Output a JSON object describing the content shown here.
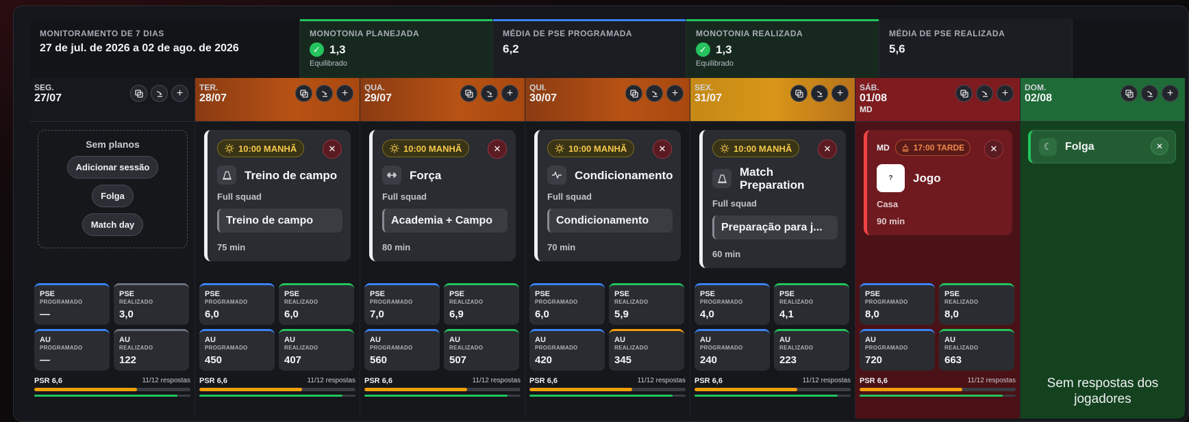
{
  "summary": {
    "monitor_label": "MONITORAMENTO DE 7 DIAS",
    "range": "27 de jul. de 2026 a 02 de ago. de 2026",
    "stats": [
      {
        "label": "MONOTONIA PLANEJADA",
        "value": "1,3",
        "note": "Equilibrado",
        "check": true,
        "accent": "#22c55e"
      },
      {
        "label": "MÉDIA DE PSE PROGRAMADA",
        "value": "6,2",
        "note": "",
        "check": false,
        "accent": "#3b82f6"
      },
      {
        "label": "MONOTONIA REALIZADA",
        "value": "1,3",
        "note": "Equilibrado",
        "check": true,
        "accent": "#22c55e"
      },
      {
        "label": "MÉDIA DE PSE REALIZADA",
        "value": "5,6",
        "note": "",
        "check": false,
        "accent": ""
      }
    ]
  },
  "labels": {
    "pse": "PSE",
    "au": "AU",
    "programado": "PROGRAMADO",
    "realizado": "REALIZADO",
    "psr": "PSR",
    "no_plans": "Sem planos",
    "add_session": "Adicionar sessão",
    "rest": "Folga",
    "match_day": "Match day",
    "no_responses": "Sem respostas dos jogadores"
  },
  "icons": {
    "copy": "copy-icon",
    "move": "arrow-turn-icon",
    "add": "plus-icon",
    "remove": "close-icon",
    "morning": "sun-icon",
    "afternoon": "sunset-icon",
    "rest": "moon-icon"
  },
  "days": [
    {
      "name": "SEG.",
      "date": "27/07",
      "tag": "",
      "kind": "empty",
      "pse_prog": "—",
      "pse_real": "3,0",
      "au_prog": "—",
      "au_real": "122",
      "pse_real_color": "#6b7280",
      "au_real_color": "#6b7280",
      "psr": "6,6",
      "responses": "11/12 respostas",
      "psr_fill": 0.66,
      "resp_fill": 0.917
    },
    {
      "name": "TER.",
      "date": "28/07",
      "tag": "",
      "kind": "session",
      "time": "10:00 MANHÃ",
      "title": "Treino de campo",
      "group": "Full squad",
      "plan": "Treino de campo",
      "duration": "75 min",
      "icon": "cone-icon",
      "pse_prog": "6,0",
      "pse_real": "6,0",
      "au_prog": "450",
      "au_real": "407",
      "pse_real_color": "#22c55e",
      "au_real_color": "#22c55e",
      "psr": "6,6",
      "responses": "11/12 respostas",
      "psr_fill": 0.66,
      "resp_fill": 0.917
    },
    {
      "name": "QUA.",
      "date": "29/07",
      "tag": "",
      "kind": "session",
      "time": "10:00 MANHÃ",
      "title": "Força",
      "group": "Full squad",
      "plan": "Academia + Campo",
      "duration": "80 min",
      "icon": "dumbbell-icon",
      "pse_prog": "7,0",
      "pse_real": "6,9",
      "au_prog": "560",
      "au_real": "507",
      "pse_real_color": "#22c55e",
      "au_real_color": "#22c55e",
      "psr": "6,6",
      "responses": "11/12 respostas",
      "psr_fill": 0.66,
      "resp_fill": 0.917
    },
    {
      "name": "QUI.",
      "date": "30/07",
      "tag": "",
      "kind": "session",
      "time": "10:00 MANHÃ",
      "title": "Condicionamento",
      "group": "Full squad",
      "plan": "Condicionamento",
      "duration": "70 min",
      "icon": "pulse-icon",
      "pse_prog": "6,0",
      "pse_real": "5,9",
      "au_prog": "420",
      "au_real": "345",
      "pse_real_color": "#22c55e",
      "au_real_color": "#f59e0b",
      "psr": "6,6",
      "responses": "11/12 respostas",
      "psr_fill": 0.66,
      "resp_fill": 0.917
    },
    {
      "name": "SEX.",
      "date": "31/07",
      "tag": "",
      "kind": "session",
      "time": "10:00 MANHÃ",
      "title": "Match Preparation",
      "group": "Full squad",
      "plan": "Preparação para j...",
      "duration": "60 min",
      "icon": "cone-icon",
      "pse_prog": "4,0",
      "pse_real": "4,1",
      "au_prog": "240",
      "au_real": "223",
      "pse_real_color": "#22c55e",
      "au_real_color": "#22c55e",
      "psr": "6,6",
      "responses": "11/12 respostas",
      "psr_fill": 0.66,
      "resp_fill": 0.917
    },
    {
      "name": "SÁB.",
      "date": "01/08",
      "tag": "MD",
      "kind": "match",
      "md": "MD",
      "time": "17:00 TARDE",
      "title": "Jogo",
      "venue": "Casa",
      "duration": "90 min",
      "badge": "?",
      "pse_prog": "8,0",
      "pse_real": "8,0",
      "au_prog": "720",
      "au_real": "663",
      "pse_real_color": "#22c55e",
      "au_real_color": "#22c55e",
      "psr": "6,6",
      "responses": "11/12 respostas",
      "psr_fill": 0.66,
      "resp_fill": 0.917
    },
    {
      "name": "DOM.",
      "date": "02/08",
      "tag": "",
      "kind": "rest",
      "title": "Folga"
    }
  ]
}
